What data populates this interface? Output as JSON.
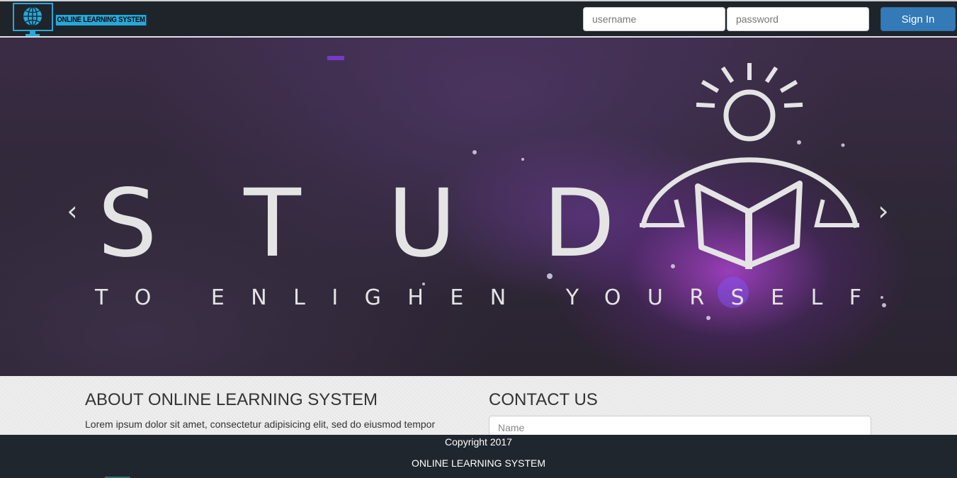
{
  "header": {
    "logo_text": "ONLINE LEARNING SYSTEM",
    "username_placeholder": "username",
    "password_placeholder": "password",
    "signin_label": "Sign In"
  },
  "hero": {
    "headline": "STUD",
    "tagline": "TO ENLIGHEN YOURSELF",
    "prev_label": "‹",
    "next_label": "›"
  },
  "about": {
    "title": "ABOUT ONLINE LEARNING SYSTEM",
    "text": "Lorem ipsum dolor sit amet, consectetur adipisicing elit, sed do eiusmod tempor incididunt ut labore et dolore magna aliqua. Ut enim ad minim veniam, quis nostrud"
  },
  "contact": {
    "title": "CONTACT US",
    "name_placeholder": "Name"
  },
  "footer": {
    "copyright": "Copyright 2017",
    "brand": "ONLINE LEARNING SYSTEM"
  },
  "colors": {
    "navbar": "#1f242b",
    "accent": "#337ab7",
    "logo": "#2aa7d8"
  }
}
